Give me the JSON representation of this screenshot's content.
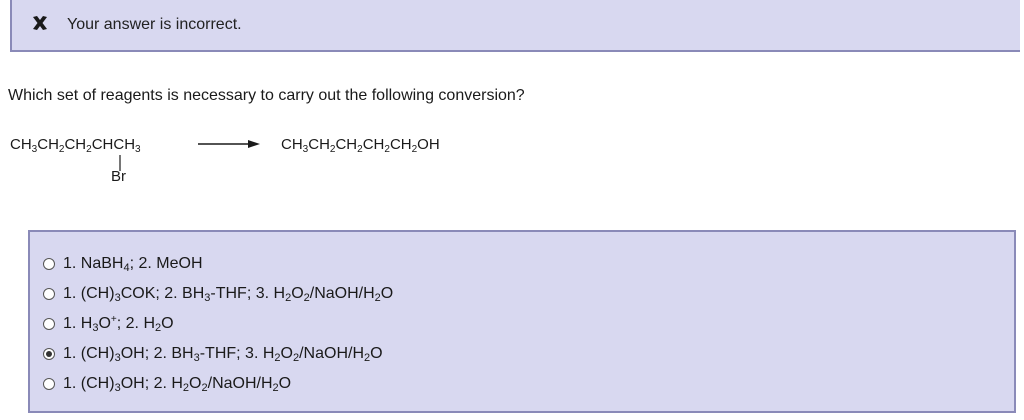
{
  "feedback": {
    "icon": "x-icon",
    "message": "Your answer is incorrect.",
    "bg_color": "#d8d8f0",
    "border_color": "#8a8ab8"
  },
  "question": {
    "text": "Which set of reagents is necessary to carry out the following conversion?"
  },
  "reaction": {
    "reactant_main": "CH3CH2CH2CHCH3",
    "reactant_substituent": "Br",
    "arrow": "right-arrow-icon",
    "product": "CH3CH2CH2CH2CH2OH"
  },
  "choices": {
    "selected_index": 3,
    "options": [
      "1. NaBH4; 2. MeOH",
      "1. (CH)3COK; 2. BH3-THF; 3. H2O2/NaOH/H2O",
      "1. H3O+; 2. H2O",
      "1. (CH)3OH; 2. BH3-THF; 3. H2O2/NaOH/H2O",
      "1. (CH)3OH; 2. H2O2/NaOH/H2O"
    ]
  }
}
